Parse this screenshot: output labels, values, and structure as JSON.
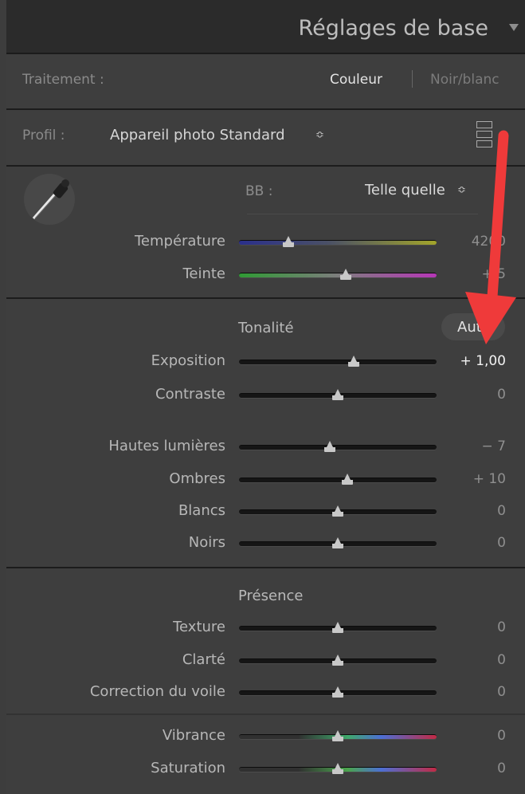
{
  "panel": {
    "title": "Réglages de base"
  },
  "treatment": {
    "label": "Traitement :",
    "color": "Couleur",
    "bw": "Noir/blanc"
  },
  "profile": {
    "label": "Profil :",
    "value": "Appareil photo Standard",
    "updown": "≎"
  },
  "wb": {
    "label": "BB :",
    "value": "Telle quelle",
    "updown": "≎"
  },
  "sliders": {
    "temperature": {
      "label": "Température",
      "value": "4200",
      "position": 0.25
    },
    "tint": {
      "label": "Teinte",
      "value": "+ 5",
      "position": 0.54
    },
    "exposure": {
      "label": "Exposition",
      "value": "+ 1,00",
      "position": 0.58
    },
    "contrast": {
      "label": "Contraste",
      "value": "0",
      "position": 0.5
    },
    "highlights": {
      "label": "Hautes lumières",
      "value": "− 7",
      "position": 0.46
    },
    "shadows": {
      "label": "Ombres",
      "value": "+ 10",
      "position": 0.55
    },
    "whites": {
      "label": "Blancs",
      "value": "0",
      "position": 0.5
    },
    "blacks": {
      "label": "Noirs",
      "value": "0",
      "position": 0.5
    },
    "texture": {
      "label": "Texture",
      "value": "0",
      "position": 0.5
    },
    "clarity": {
      "label": "Clarté",
      "value": "0",
      "position": 0.5
    },
    "dehaze": {
      "label": "Correction du voile",
      "value": "0",
      "position": 0.5
    },
    "vibrance": {
      "label": "Vibrance",
      "value": "0",
      "position": 0.5
    },
    "saturation": {
      "label": "Saturation",
      "value": "0",
      "position": 0.5
    }
  },
  "tone": {
    "title": "Tonalité",
    "auto": "Auto"
  },
  "presence": {
    "title": "Présence"
  },
  "colors": {
    "annotation_arrow": "#ef3a3a",
    "panel": "#3e3e3e",
    "header": "#2b2b2b"
  }
}
